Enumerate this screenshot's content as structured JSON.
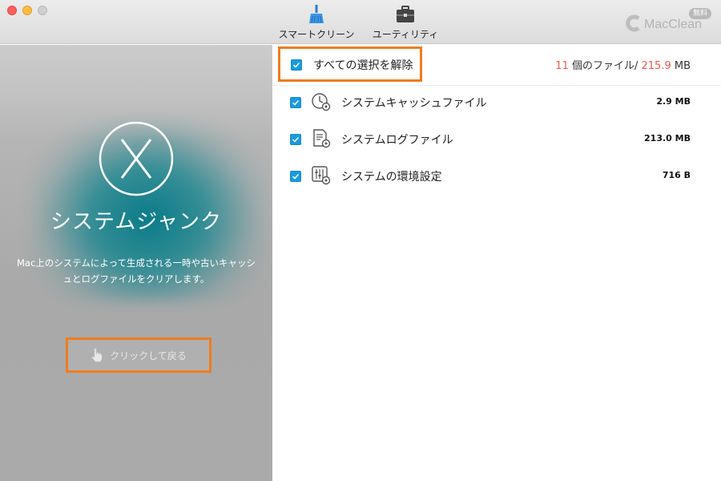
{
  "toolbar": {
    "items": [
      {
        "label": "スマートクリーン",
        "icon": "broom-icon"
      },
      {
        "label": "ユーティリティ",
        "icon": "toolbox-icon"
      }
    ],
    "brand": {
      "name": "MacClean",
      "badge": "無料"
    }
  },
  "left_panel": {
    "title": "システムジャンク",
    "description": "Mac上のシステムによって生成される一時や古いキャッシュとログファイルをクリアします。",
    "back_button_label": "クリックして戻る",
    "accent_color": "#0c7f8a"
  },
  "right_panel": {
    "select_all_label": "すべての選択を解除",
    "summary": {
      "count": "11",
      "count_suffix": " 個のファイル/ ",
      "size": "215.9",
      "size_unit": " MB"
    },
    "items": [
      {
        "label": "システムキャッシュファイル",
        "size": "2.9 MB",
        "icon": "cache-clock-gear-icon",
        "checked": true
      },
      {
        "label": "システムログファイル",
        "size": "213.0 MB",
        "icon": "log-document-gear-icon",
        "checked": true
      },
      {
        "label": "システムの環境設定",
        "size": "716 B",
        "icon": "preferences-sliders-gear-icon",
        "checked": true
      }
    ]
  },
  "colors": {
    "checkbox": "#1a9ae0",
    "highlight_border": "#f07c1d",
    "summary_number": "#f0584a"
  }
}
